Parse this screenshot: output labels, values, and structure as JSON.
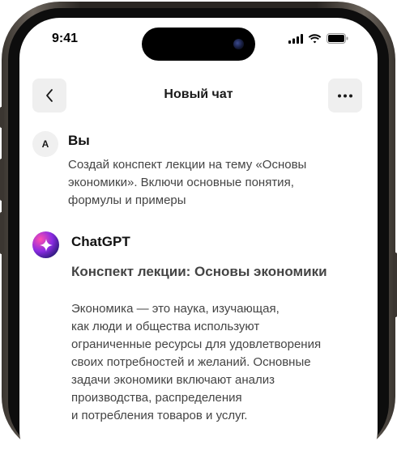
{
  "status_bar": {
    "time": "9:41",
    "icons": [
      "signal-icon",
      "wifi-icon",
      "battery-icon"
    ]
  },
  "header": {
    "title": "Новый чат",
    "back_icon": "chevron-left-icon",
    "more_icon": "ellipsis-icon"
  },
  "messages": [
    {
      "author": "Вы",
      "avatar_letter": "A",
      "lines": [
        "Создай конспект лекции на тему «Основы",
        "экономики». Включи основные понятия,",
        "формулы и примеры"
      ]
    },
    {
      "author": "ChatGPT",
      "avatar_icon": "sparkle-icon",
      "heading": "Конспект лекции: Основы экономики",
      "lines": [
        "Экономика — это наука, изучающая,",
        "как люди и общества используют",
        "ограниченные ресурсы для удовлетворения",
        "своих потребностей и желаний. Основные",
        "задачи экономики включают анализ",
        "производства, распределения",
        "и потребления товаров и услуг."
      ]
    }
  ],
  "colors": {
    "background": "#ffffff",
    "button_bg": "#efefef",
    "text_primary": "#111111",
    "text_secondary": "#444444"
  }
}
